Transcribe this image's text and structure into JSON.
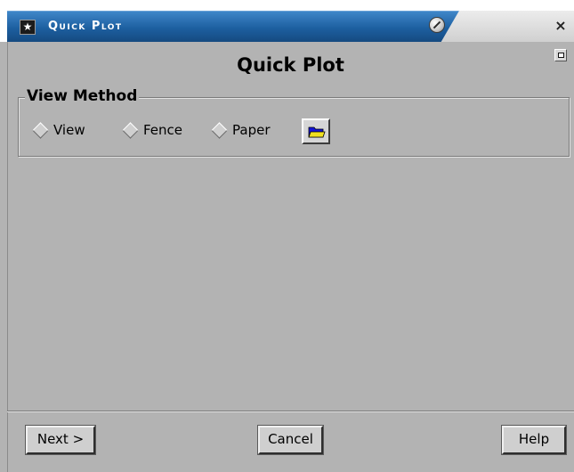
{
  "window": {
    "title": "Quick Plot",
    "app_icon": "star-icon",
    "pin_icon": "pin-icon",
    "close_symbol": "×"
  },
  "dialog": {
    "heading": "Quick Plot"
  },
  "view_method": {
    "legend": "View Method",
    "options": [
      {
        "label": "View",
        "selected": false
      },
      {
        "label": "Fence",
        "selected": false
      },
      {
        "label": "Paper",
        "selected": false
      }
    ],
    "open_button_icon": "open-folder-icon"
  },
  "footer": {
    "next_label": "Next >",
    "cancel_label": "Cancel",
    "help_label": "Help"
  },
  "colors": {
    "titlebar_blue": "#1d5fa0",
    "background": "#b3b3b3",
    "folder_blue": "#1414d8",
    "folder_yellow": "#f0e020"
  }
}
